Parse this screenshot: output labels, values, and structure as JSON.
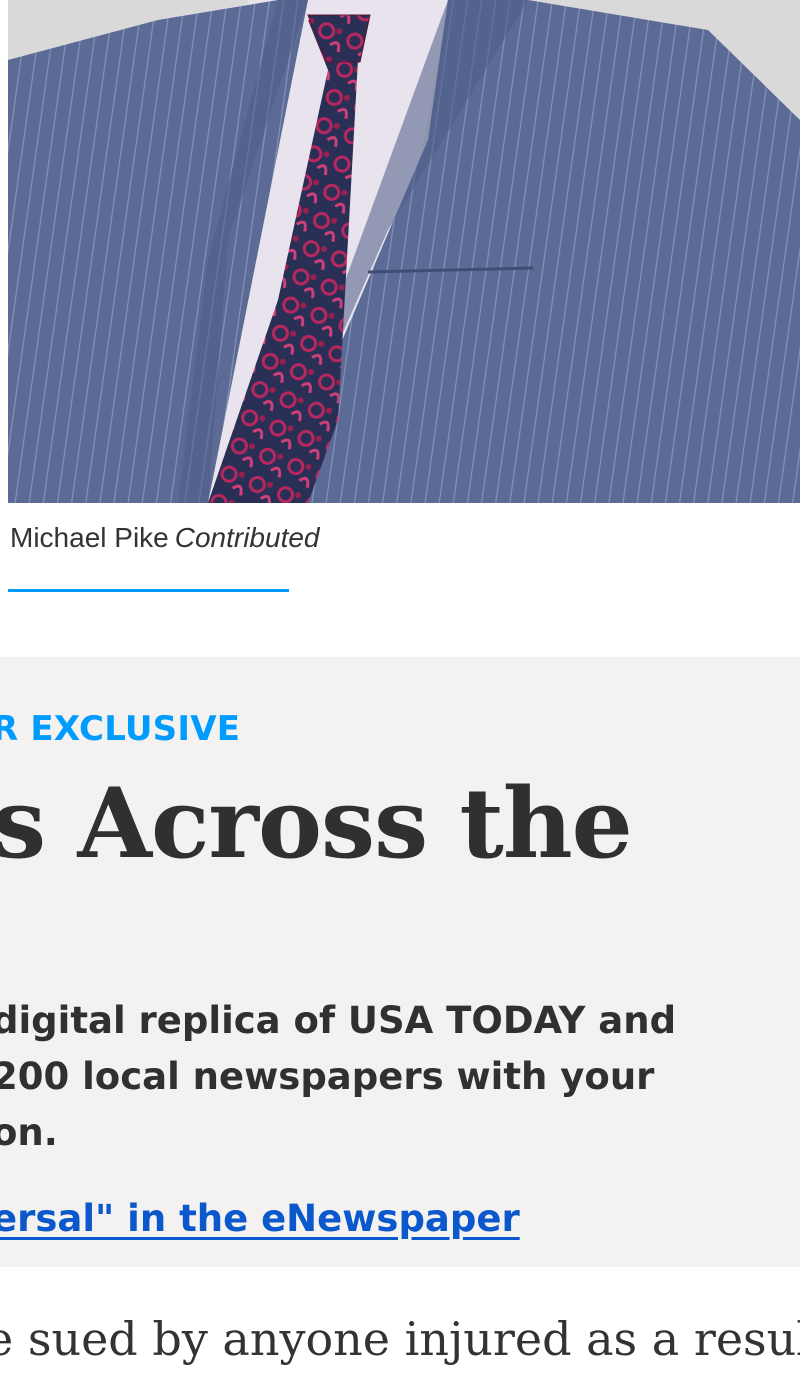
{
  "photo": {
    "alt_subject": "man in pinstripe suit with paisley tie",
    "colors": {
      "background": "#d9d9d9",
      "suit": "#5b6b96",
      "shirt": "#e8e3ec",
      "tie": "#8a1f4a"
    }
  },
  "caption": {
    "name": "Michael Pike",
    "credit": "Contributed"
  },
  "colors": {
    "accent": "#009bff",
    "link": "#0a58cc",
    "promo_bg": "#f3f2f1",
    "text": "#303030"
  },
  "promo": {
    "eyebrow": "R EXCLUSIVE",
    "headline": "s Across the",
    "body_lines": [
      " digital replica of USA TODAY and",
      "200 local newspapers with your",
      "on."
    ],
    "link_text": "ersal\" in the eNewspaper"
  },
  "article": {
    "line": "e sued by anyone injured as a result of"
  }
}
